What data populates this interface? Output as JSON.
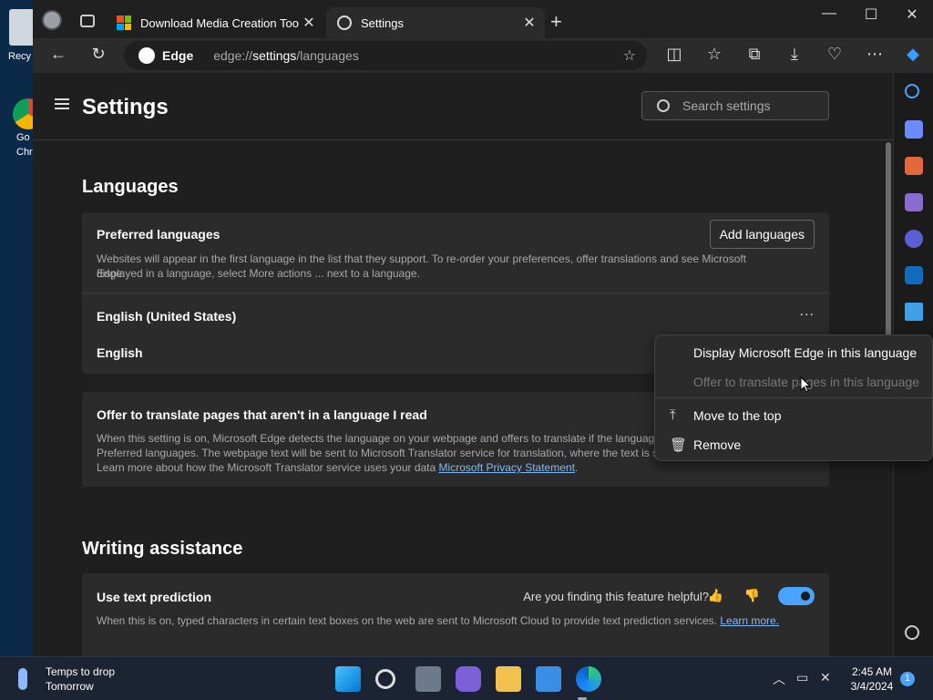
{
  "desktop": {
    "recycle_label": "Recy",
    "chrome_label_1": "Go",
    "chrome_label_2": "Chr"
  },
  "tabs": [
    {
      "title": "Download Media Creation Tool -",
      "close": "✕"
    },
    {
      "title": "Settings",
      "close": "✕"
    }
  ],
  "new_tab": "+",
  "window_controls": {
    "minimize": "—",
    "maximize": "☐",
    "close": "✕"
  },
  "toolbar": {
    "site_name": "Edge",
    "url_prefix": "edge://",
    "url_host": "settings",
    "url_path": "/languages",
    "star": "☆"
  },
  "settings": {
    "page_title": "Settings",
    "search_placeholder": "Search settings",
    "languages_heading": "Languages",
    "preferred": {
      "title": "Preferred languages",
      "button": "Add languages",
      "desc_1": "Websites will appear in the first language in the list that they support. To re-order your preferences, offer translations and see Microsoft Edge",
      "desc_2": "displayed in a language, select More actions ... next to a language.",
      "languages": [
        "English (United States)",
        "English"
      ],
      "more": "..."
    },
    "translate": {
      "title": "Offer to translate pages that aren't in a language I read",
      "desc_1": "When this setting is on, Microsoft Edge detects the language on your webpage and offers to translate if the languag",
      "desc_2": "Preferred languages. The webpage text will be sent to Microsoft Translator service for translation, where the text is st",
      "desc_3": "Learn more about how the Microsoft Translator service uses your data",
      "link": "Microsoft Privacy Statement",
      "link_tail": "."
    },
    "writing_heading": "Writing assistance",
    "prediction": {
      "title": "Use text prediction",
      "helpful": "Are you finding this feature helpful?",
      "desc": "When this is on, typed characters in certain text boxes on the web are sent to Microsoft Cloud to provide text prediction services.",
      "link": "Learn more."
    }
  },
  "context_menu": {
    "items": [
      {
        "label": "Display Microsoft Edge in this language",
        "disabled": false
      },
      {
        "label": "Offer to translate pages in this language",
        "disabled": true
      },
      {
        "label": "Move to the top",
        "disabled": false
      },
      {
        "label": "Remove",
        "disabled": false
      }
    ]
  },
  "taskbar": {
    "weather_line1": "Temps to drop",
    "weather_line2": "Tomorrow",
    "time": "2:45 AM",
    "date": "3/4/2024",
    "notifications": "1"
  },
  "colors": {
    "accent": "#4aa3ff",
    "background": "#1f1f1f",
    "card": "#2b2b2b"
  }
}
